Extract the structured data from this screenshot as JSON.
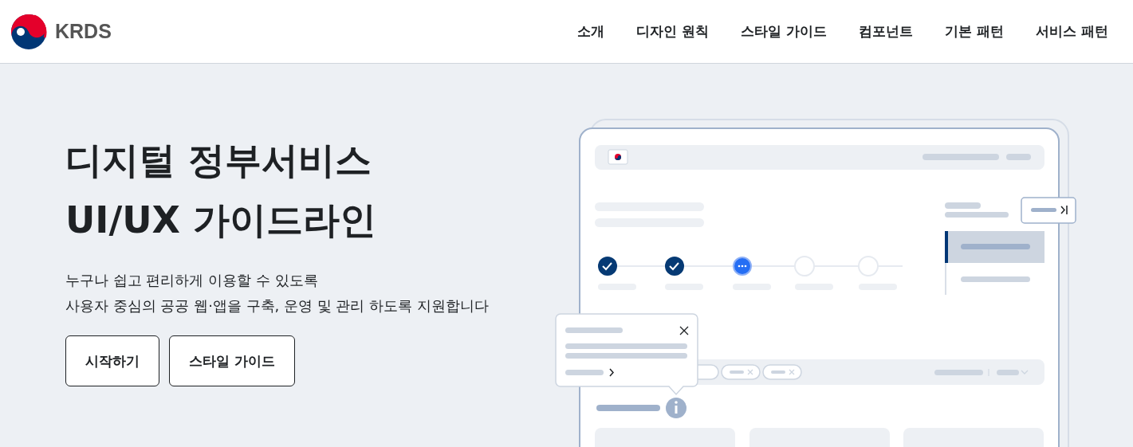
{
  "logo": {
    "text": "KRDS"
  },
  "nav": [
    "소개",
    "디자인 원칙",
    "스타일 가이드",
    "컴포넌트",
    "기본 패턴",
    "서비스 패턴"
  ],
  "hero": {
    "title_lines": [
      "디지털 정부서비스",
      "UI/UX 가이드라인"
    ],
    "description_lines": [
      "누구나 쉽고 편리하게 이용할 수 있도록",
      "사용자 중심의 공공 웹·앱을 구축, 운영 및 관리 하도록 지원합니다"
    ],
    "buttons": [
      "시작하기",
      "스타일 가이드"
    ]
  }
}
